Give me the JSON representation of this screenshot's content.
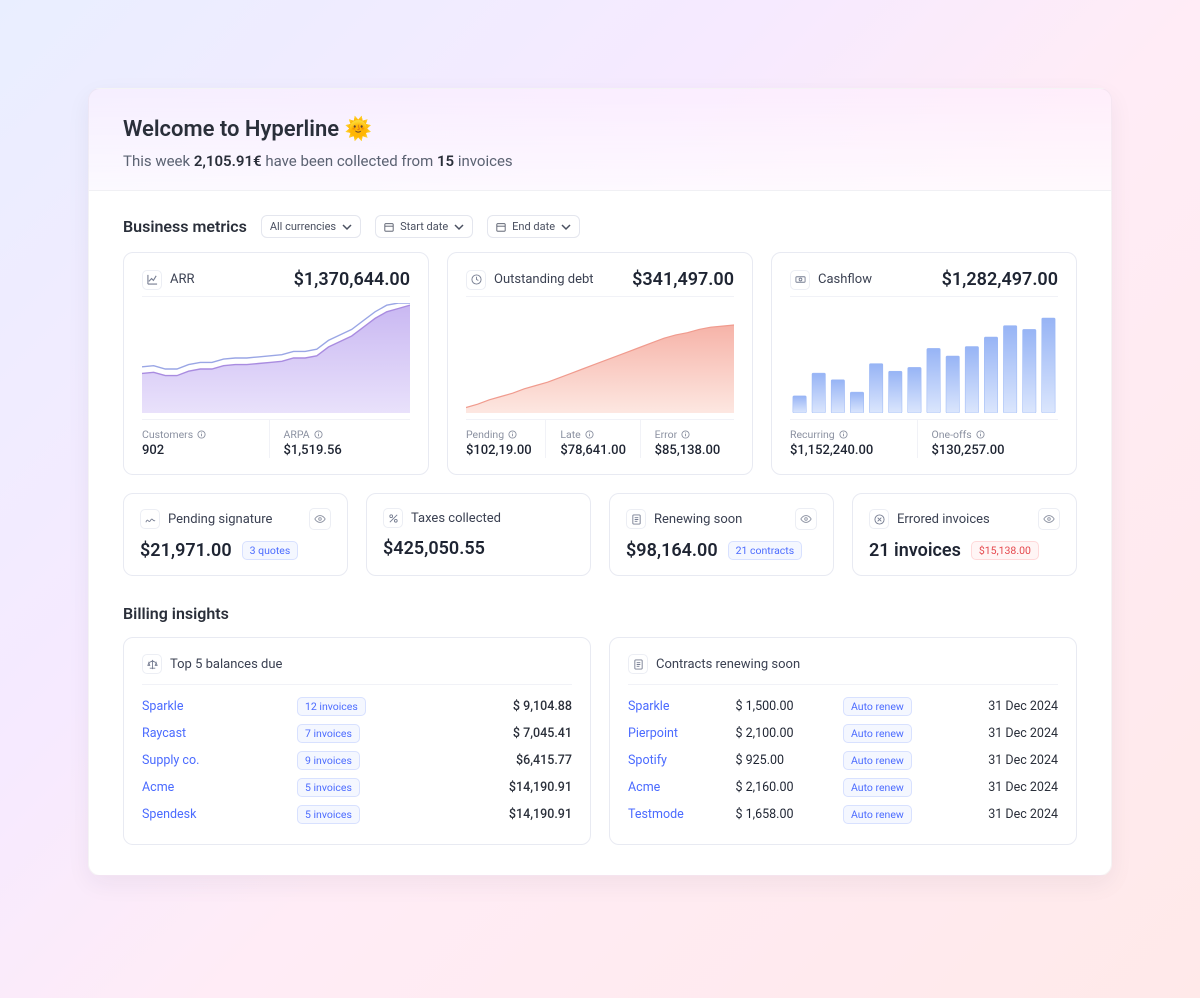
{
  "hero": {
    "title": "Welcome to Hyperline 🌞",
    "line_prefix": "This week ",
    "amount": "2,105.91€",
    "line_mid": " have been collected from ",
    "count": "15",
    "line_suffix": " invoices"
  },
  "filters": {
    "section_title": "Business metrics",
    "currency": "All currencies",
    "start": "Start date",
    "end": "End date"
  },
  "cards": {
    "arr": {
      "title": "ARR",
      "value": "$1,370,644.00",
      "subs": [
        {
          "lbl": "Customers",
          "val": "902"
        },
        {
          "lbl": "ARPA",
          "val": "$1,519.56"
        }
      ]
    },
    "debt": {
      "title": "Outstanding debt",
      "value": "$341,497.00",
      "subs": [
        {
          "lbl": "Pending",
          "val": "$102,19.00"
        },
        {
          "lbl": "Late",
          "val": "$78,641.00"
        },
        {
          "lbl": "Error",
          "val": "$85,138.00"
        }
      ]
    },
    "cash": {
      "title": "Cashflow",
      "value": "$1,282,497.00",
      "subs": [
        {
          "lbl": "Recurring",
          "val": "$1,152,240.00"
        },
        {
          "lbl": "One-offs",
          "val": "$130,257.00"
        }
      ]
    }
  },
  "mini": {
    "pending": {
      "title": "Pending signature",
      "value": "$21,971.00",
      "chip": "3 quotes"
    },
    "taxes": {
      "title": "Taxes collected",
      "value": "$425,050.55"
    },
    "renew": {
      "title": "Renewing soon",
      "value": "$98,164.00",
      "chip": "21 contracts"
    },
    "errored": {
      "title": "Errored invoices",
      "value": "21 invoices",
      "chip": "$15,138.00"
    }
  },
  "insights_title": "Billing insights",
  "balances": {
    "title": "Top 5 balances due",
    "rows": [
      {
        "name": "Sparkle",
        "chip": "12 invoices",
        "amt": "$ 9,104.88"
      },
      {
        "name": "Raycast",
        "chip": "7 invoices",
        "amt": "$ 7,045.41"
      },
      {
        "name": "Supply co.",
        "chip": "9 invoices",
        "amt": "$6,415.77"
      },
      {
        "name": "Acme",
        "chip": "5 invoices",
        "amt": "$14,190.91"
      },
      {
        "name": "Spendesk",
        "chip": "5 invoices",
        "amt": "$14,190.91"
      }
    ]
  },
  "contracts": {
    "title": "Contracts renewing soon",
    "chip_label": "Auto renew",
    "rows": [
      {
        "name": "Sparkle",
        "amt": "$ 1,500.00",
        "date": "31 Dec 2024"
      },
      {
        "name": "Pierpoint",
        "amt": "$ 2,100.00",
        "date": "31 Dec 2024"
      },
      {
        "name": "Spotify",
        "amt": "$ 925.00",
        "date": "31 Dec 2024"
      },
      {
        "name": "Acme",
        "amt": "$ 2,160.00",
        "date": "31 Dec 2024"
      },
      {
        "name": "Testmode",
        "amt": "$ 1,658.00",
        "date": "31 Dec 2024"
      }
    ]
  },
  "chart_data": [
    {
      "type": "area",
      "title": "ARR",
      "series": [
        {
          "name": "ARR",
          "values": [
            0.36,
            0.37,
            0.34,
            0.34,
            0.38,
            0.4,
            0.4,
            0.43,
            0.44,
            0.44,
            0.45,
            0.46,
            0.47,
            0.5,
            0.5,
            0.52,
            0.6,
            0.65,
            0.7,
            0.78,
            0.86,
            0.92,
            0.95,
            0.98
          ]
        }
      ],
      "ylim": [
        0,
        1
      ]
    },
    {
      "type": "area",
      "title": "Outstanding debt",
      "series": [
        {
          "name": "debt",
          "values": [
            0.05,
            0.08,
            0.12,
            0.15,
            0.18,
            0.22,
            0.25,
            0.28,
            0.32,
            0.36,
            0.4,
            0.44,
            0.48,
            0.52,
            0.56,
            0.6,
            0.64,
            0.68,
            0.71,
            0.73,
            0.76,
            0.78,
            0.79,
            0.8
          ]
        }
      ],
      "ylim": [
        0,
        1
      ]
    },
    {
      "type": "bar",
      "title": "Cashflow",
      "values": [
        0.18,
        0.42,
        0.35,
        0.22,
        0.52,
        0.44,
        0.48,
        0.68,
        0.6,
        0.7,
        0.8,
        0.92,
        0.88,
        1.0
      ],
      "ylim": [
        0,
        1
      ]
    }
  ]
}
